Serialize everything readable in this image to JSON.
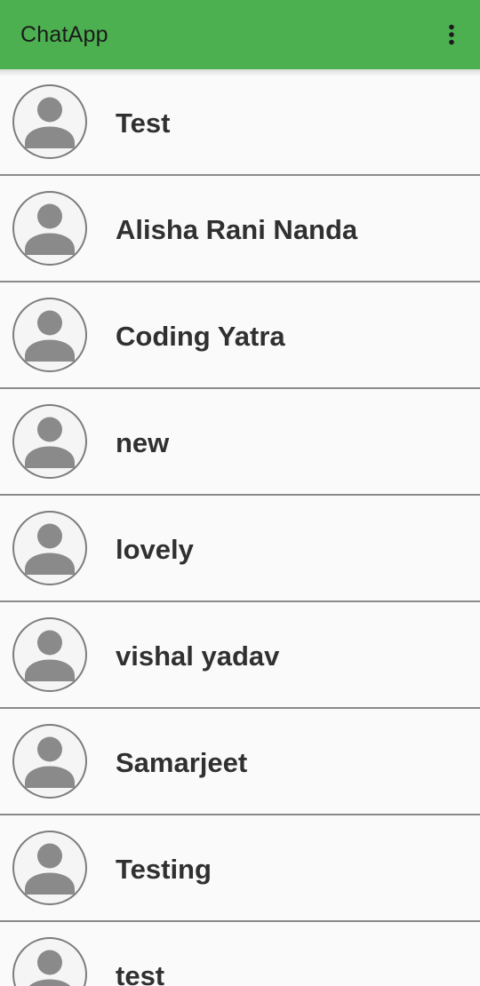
{
  "app_bar": {
    "title": "ChatApp",
    "menu_icon": "more-vert-icon",
    "background_color": "#4caf50"
  },
  "contacts": [
    {
      "name": "Test",
      "avatar_icon": "person-icon"
    },
    {
      "name": "Alisha Rani Nanda",
      "avatar_icon": "person-icon"
    },
    {
      "name": "Coding Yatra",
      "avatar_icon": "person-icon"
    },
    {
      "name": "new",
      "avatar_icon": "person-icon"
    },
    {
      "name": "lovely",
      "avatar_icon": "person-icon"
    },
    {
      "name": "vishal yadav",
      "avatar_icon": "person-icon"
    },
    {
      "name": "Samarjeet",
      "avatar_icon": "person-icon"
    },
    {
      "name": "Testing",
      "avatar_icon": "person-icon"
    },
    {
      "name": "test",
      "avatar_icon": "person-icon"
    }
  ]
}
